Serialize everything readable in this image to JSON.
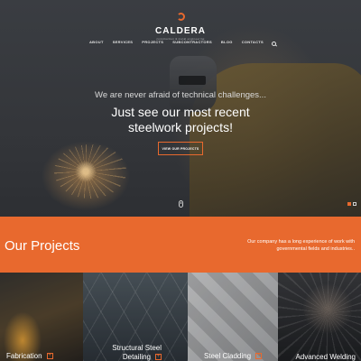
{
  "brand": {
    "name": "CALDERA",
    "tagline": "construction & metal engineering",
    "accent_color": "#e8692e"
  },
  "nav": {
    "items": [
      {
        "label": "ABOUT"
      },
      {
        "label": "SERVICES"
      },
      {
        "label": "PROJECTS"
      },
      {
        "label": "SUBCONTRACTORS"
      },
      {
        "label": "BLOG"
      },
      {
        "label": "CONTACTS"
      }
    ],
    "search_icon": "search-icon"
  },
  "hero": {
    "subtitle": "We are never afraid of technical challenges...",
    "title_line1": "Just see our most recent",
    "title_line2": "steelwork projects!",
    "button_label": "VIEW OUR PROJECTS",
    "scroll_icon": "mouse-scroll-icon",
    "slides_total": 2,
    "slide_active": 1
  },
  "projects": {
    "title": "Our Projects",
    "description": "Our company has a long experience of work with governmental fields and industries..",
    "tiles": [
      {
        "label": "Fabrication",
        "icon": "plus-icon"
      },
      {
        "label": "Structural Steel Detailing",
        "icon": "plus-icon"
      },
      {
        "label": "Steel Cladding",
        "icon": "plus-icon"
      },
      {
        "label": "Advanced Welding",
        "icon": "plus-icon"
      }
    ]
  }
}
